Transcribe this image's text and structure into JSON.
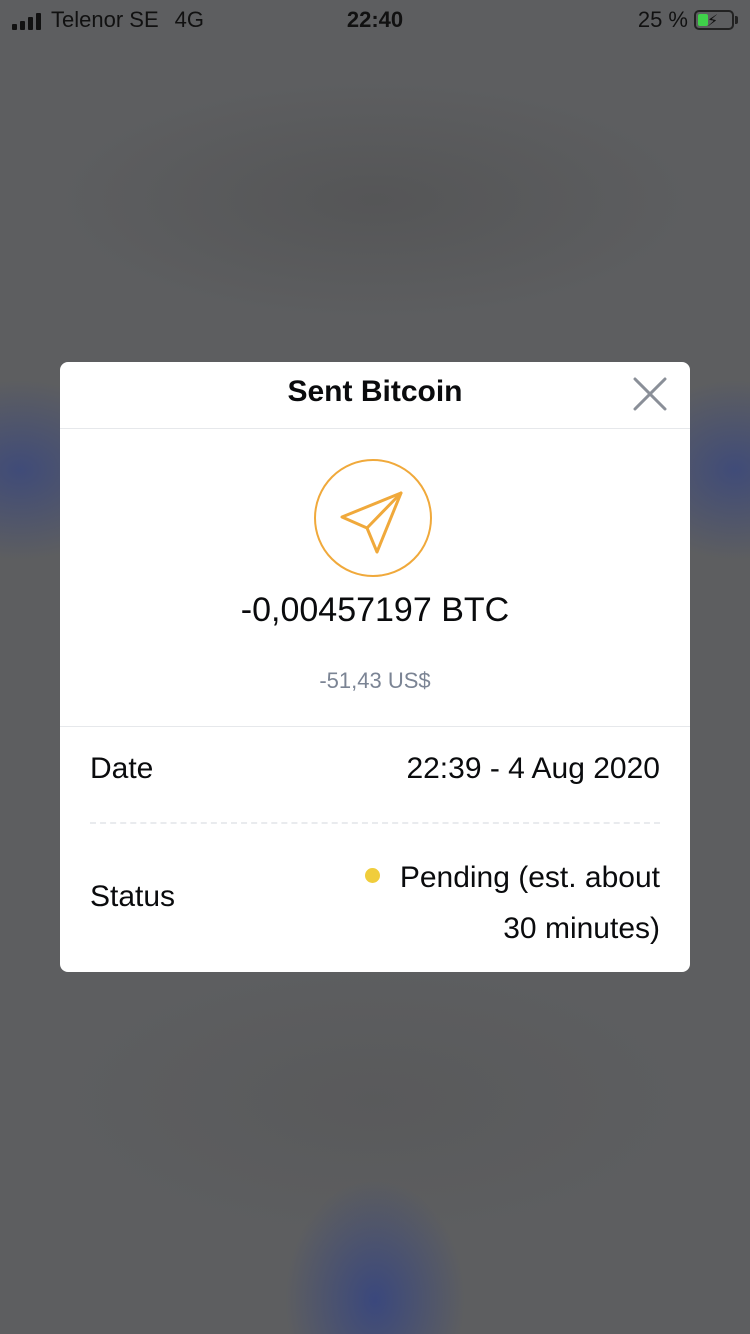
{
  "status_bar": {
    "carrier": "Telenor SE",
    "network": "4G",
    "time": "22:40",
    "battery_percent": "25 %",
    "battery_level": 0.25
  },
  "modal": {
    "title": "Sent Bitcoin",
    "close_icon": "close-icon",
    "sent_icon": "paper-plane-icon",
    "accent_color": "#f0a93b",
    "amount_crypto": "-0,00457197 BTC",
    "amount_fiat": "-51,43 US$",
    "details": {
      "date_label": "Date",
      "date_value": "22:39 - 4 Aug 2020",
      "status_label": "Status",
      "status_value": "Pending (est. about 30 minutes)",
      "status_color": "#f0cd3c"
    }
  }
}
